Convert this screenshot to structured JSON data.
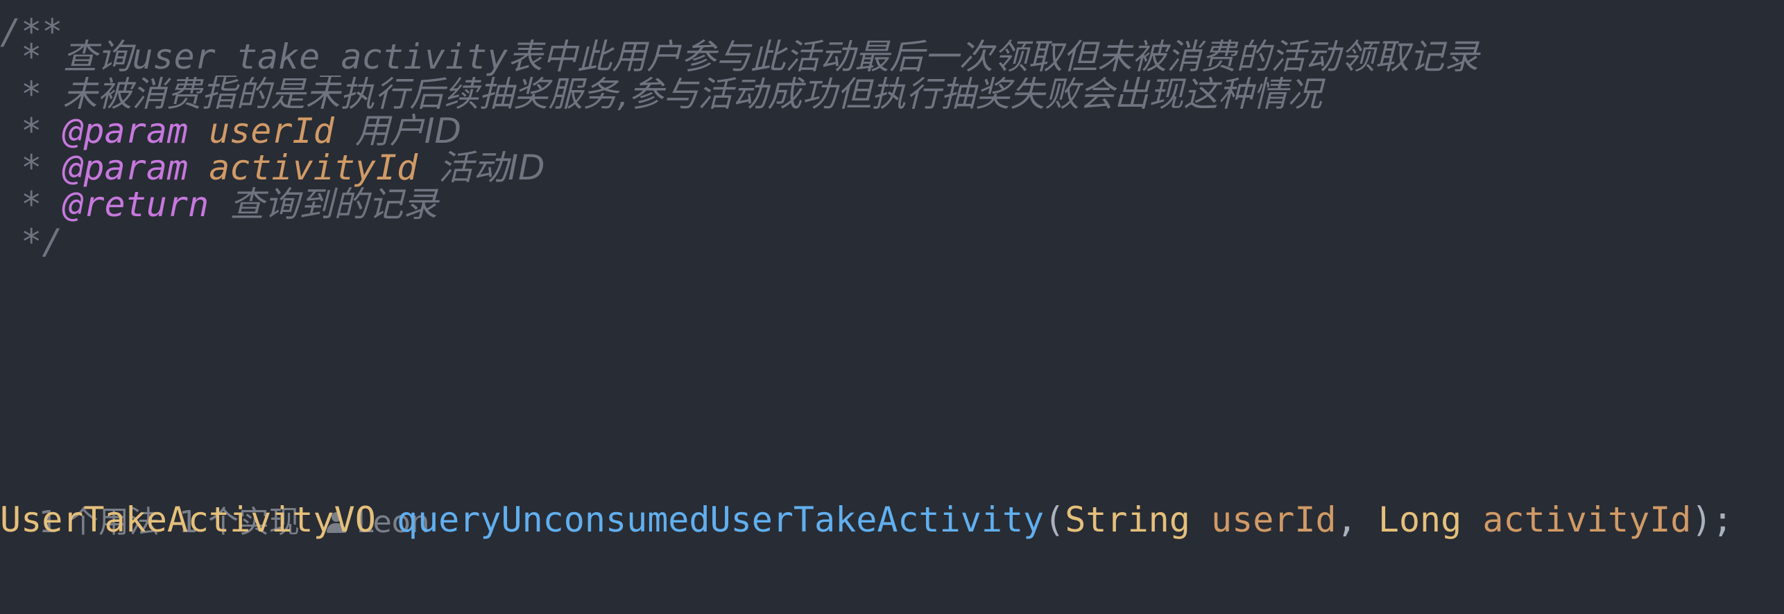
{
  "doc_comment": {
    "open": "/**",
    "desc_line1_prefix": "查询",
    "desc_line1_code": "user_take_activity",
    "desc_line1_suffix": "表中此用户参与此活动最后一次领取但未被消费的活动领取记录",
    "desc_line2": "未被消费指的是未执行后续抽奖服务,参与活动成功但执行抽奖失败会出现这种情况",
    "param1_tag": "@param",
    "param1_name": "userId",
    "param1_desc": "用户ID",
    "param2_tag": "@param",
    "param2_name": "activityId",
    "param2_desc": "活动ID",
    "return_tag": "@return",
    "return_desc": "查询到的记录",
    "close": " */",
    "star": " *"
  },
  "inlay_hints": {
    "usages": "1 个用法",
    "implementations": "1 个实现",
    "author": "Leon"
  },
  "signature": {
    "return_type": "UserTakeActivityVO",
    "method_name": "queryUnconsumedUserTakeActivity",
    "open_paren": "(",
    "param1_type": "String",
    "param1_name": "userId",
    "comma": ", ",
    "param2_type": "Long",
    "param2_name": "activityId",
    "close": ");"
  },
  "colors": {
    "background": "#282c34",
    "comment": "#6f7480",
    "tag": "#c678dd",
    "param": "#d19a66",
    "type": "#e5c07b",
    "function": "#61afef"
  }
}
